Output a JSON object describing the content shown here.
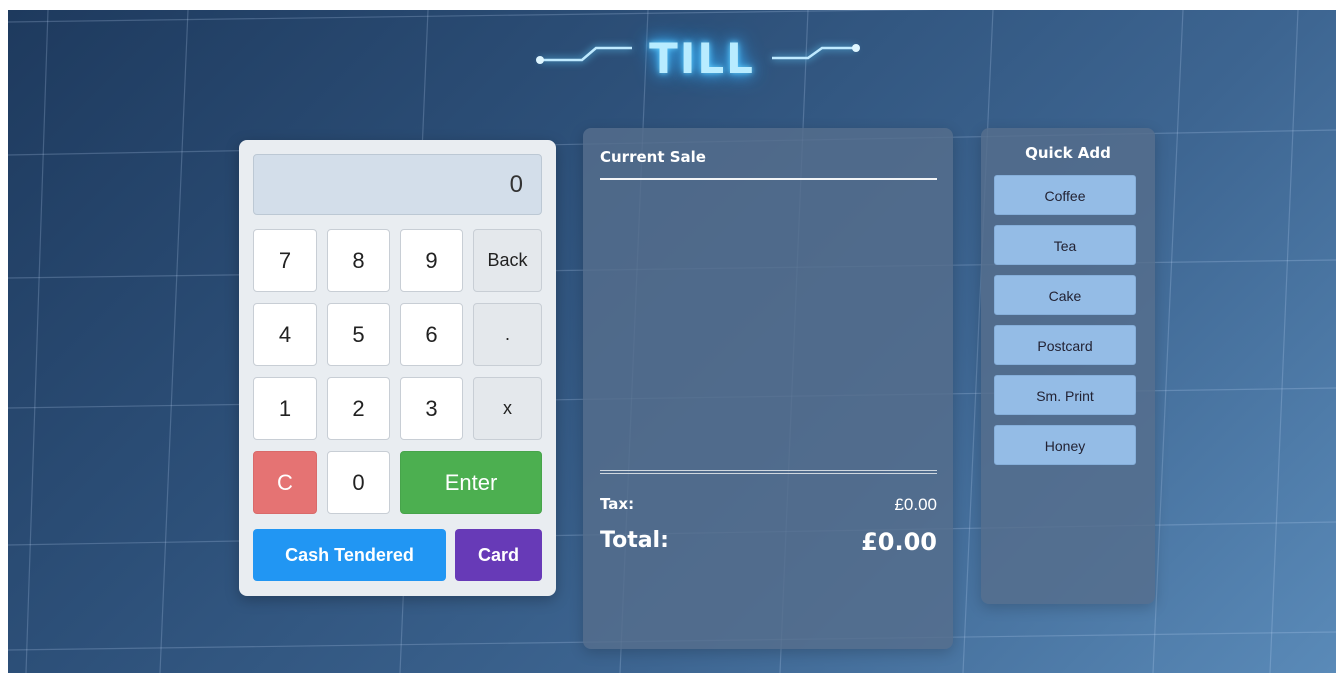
{
  "title": "TILL",
  "keypad": {
    "display_value": "0",
    "rows": [
      [
        "7",
        "8",
        "9",
        "Back"
      ],
      [
        "4",
        "5",
        "6",
        "."
      ],
      [
        "1",
        "2",
        "3",
        "x"
      ]
    ],
    "clear_label": "C",
    "zero_label": "0",
    "enter_label": "Enter",
    "cash_label": "Cash Tendered",
    "card_label": "Card"
  },
  "sale": {
    "title": "Current Sale",
    "items": [],
    "tax_label": "Tax:",
    "tax_value": "£0.00",
    "total_label": "Total:",
    "total_value": "£0.00"
  },
  "quick_add": {
    "title": "Quick Add",
    "items": [
      "Coffee",
      "Tea",
      "Cake",
      "Postcard",
      "Sm. Print",
      "Honey"
    ]
  },
  "colors": {
    "clear": "#e57373",
    "enter": "#4caf50",
    "cash": "#2196f3",
    "card": "#673ab7",
    "quick_item": "#94bce6",
    "title_glow": "#5fd0ff"
  }
}
